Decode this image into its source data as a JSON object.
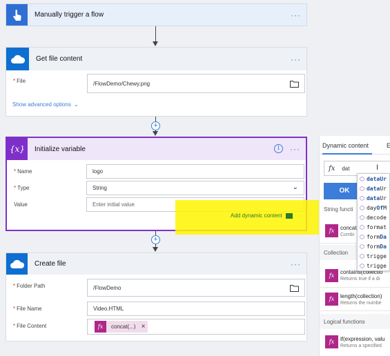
{
  "trigger": {
    "title": "Manually trigger a flow",
    "icon": "hand-tap-icon",
    "color": "#2f6fd3"
  },
  "get_file": {
    "title": "Get file content",
    "icon": "cloud-icon",
    "color": "#0f6ed1",
    "file_label": "File",
    "file_value": "/FlowDemo/Chewy.png",
    "advanced_link": "Show advanced options"
  },
  "init_var": {
    "title": "Initialize variable",
    "icon": "variable-icon",
    "color": "#7f2fc9",
    "name_label": "Name",
    "name_value": "logo",
    "type_label": "Type",
    "type_value": "String",
    "value_label": "Value",
    "value_placeholder": "Enter initial value",
    "add_dynamic": "Add dynamic content"
  },
  "create_file": {
    "title": "Create file",
    "icon": "cloud-icon",
    "color": "#0f6ed1",
    "folder_label": "Folder Path",
    "folder_value": "/FlowDemo",
    "name_label": "File Name",
    "name_value": "Video.HTML",
    "content_label": "File Content",
    "token_label": "concat(...)",
    "token_close": "×"
  },
  "panel": {
    "tab_dynamic": "Dynamic content",
    "tab_expression": "E",
    "expression_value": "dat",
    "fx_label": "fx",
    "ok_label": "OK",
    "sections": {
      "string": "String functi",
      "collection": "Collection",
      "logical": "Logical functions"
    },
    "items": [
      {
        "name": "concat(",
        "desc": "Combi"
      },
      {
        "name": "contains(collectio",
        "desc": "Returns true if a di"
      },
      {
        "name": "length(collection)",
        "desc": "Returns the numbe"
      },
      {
        "name": "if(expression, valu",
        "desc": "Returns a specified"
      }
    ]
  },
  "autocomplete": [
    {
      "match": "data",
      "rest": "Ur"
    },
    {
      "match": "data",
      "rest": "Ur"
    },
    {
      "match": "data",
      "rest": "Ur"
    },
    {
      "pre": "day",
      "match": "Of",
      "rest": "M"
    },
    {
      "pre": "decode",
      "match": "",
      "rest": ""
    },
    {
      "pre": "format",
      "match": "",
      "rest": ""
    },
    {
      "pre": "form",
      "match": "Da",
      "rest": ""
    },
    {
      "pre": "form",
      "match": "Da",
      "rest": ""
    },
    {
      "pre": "trigge",
      "match": "",
      "rest": ""
    },
    {
      "pre": "trigge",
      "match": "",
      "rest": ""
    }
  ],
  "colors": {
    "accent": "#3b7dd8",
    "purple": "#7f2fc9",
    "expression_fx": "#b0278a",
    "highlight": "#fff500"
  }
}
